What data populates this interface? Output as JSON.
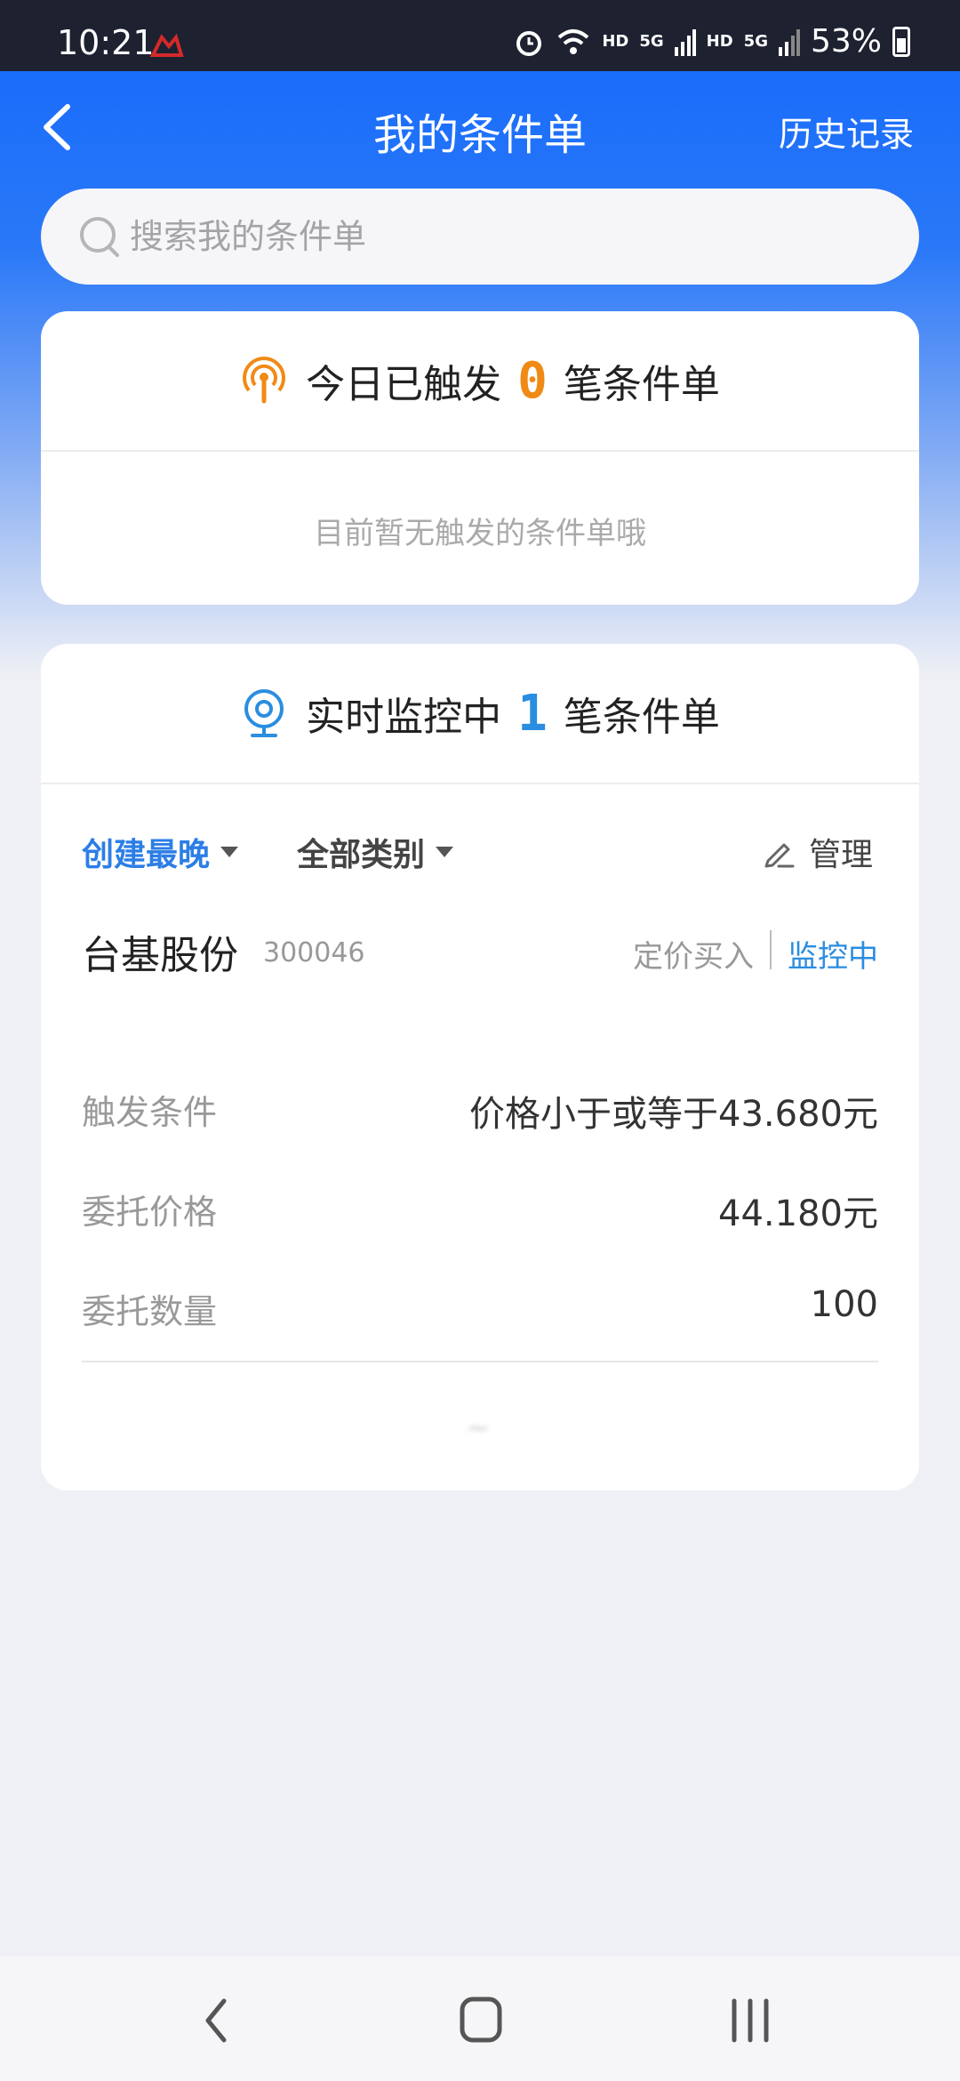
{
  "status_bar": {
    "time": "10:21",
    "hd1": "HD",
    "net1": "5G",
    "hd2": "HD",
    "net2": "5G",
    "battery": "53%"
  },
  "header": {
    "title": "我的条件单",
    "history_label": "历史记录"
  },
  "search": {
    "placeholder": "搜索我的条件单"
  },
  "triggered_card": {
    "prefix": "今日已触发",
    "count": "0",
    "suffix": "笔条件单",
    "empty_text": "目前暂无触发的条件单哦",
    "accent_color": "#f08a16"
  },
  "monitoring_card": {
    "prefix": "实时监控中",
    "count": "1",
    "suffix": "笔条件单",
    "accent_color": "#2b8de0",
    "filters": {
      "sort_label": "创建最晚",
      "category_label": "全部类别",
      "manage_label": "管理"
    },
    "order": {
      "stock_name": "台基股份",
      "stock_code": "300046",
      "order_type": "定价买入",
      "status": "监控中",
      "details": [
        {
          "label": "触发条件",
          "value": "价格小于或等于43.680元"
        },
        {
          "label": "委托价格",
          "value": "44.180元"
        },
        {
          "label": "委托数量",
          "value": "100"
        }
      ],
      "footer_text": "~"
    }
  },
  "colors": {
    "header_blue": "#1a6dfa",
    "link_blue": "#2c7ee6",
    "background": "#eff0f5"
  }
}
